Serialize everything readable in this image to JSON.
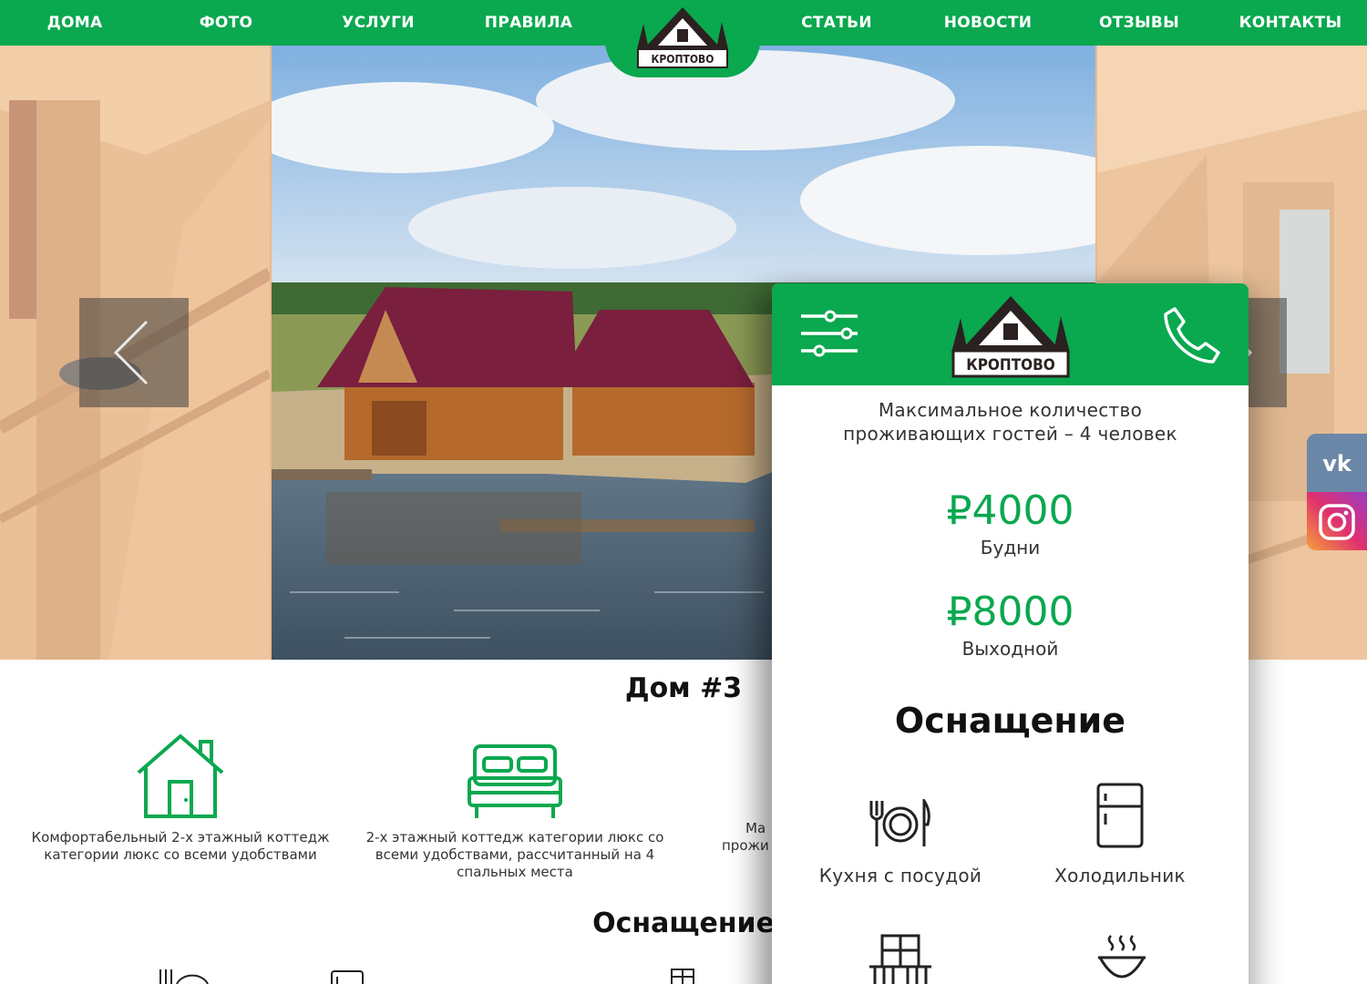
{
  "nav": {
    "items": [
      {
        "label": "ДОМА"
      },
      {
        "label": "ФОТО"
      },
      {
        "label": "УСЛУГИ"
      },
      {
        "label": "ПРАВИЛА"
      },
      {
        "label": "СТАТЬИ"
      },
      {
        "label": "НОВОСТИ"
      },
      {
        "label": "ОТЗЫВЫ"
      },
      {
        "label": "КОНТАКТЫ"
      }
    ],
    "logo_text": "КРОПТОВО"
  },
  "colors": {
    "brand_green": "#0aa84f",
    "roof": "#7a1f3d",
    "vk": "#6b87a8"
  },
  "hero": {
    "arrow_left_icon": "chevron-left-icon",
    "arrow_right_icon": "chevron-right-icon"
  },
  "social": [
    {
      "name": "vk-icon"
    },
    {
      "name": "instagram-icon"
    }
  ],
  "house": {
    "title": "Дом #3",
    "features": [
      {
        "icon": "house-icon",
        "text": "Комфортабельный 2-х этажный коттедж категории люкс со всеми удобствами"
      },
      {
        "icon": "bed-icon",
        "text": "2-х этажный коттедж категории люкс со всеми удобствами, рассчитанный на 4 спальных места"
      },
      {
        "icon": "",
        "text": "Ма"
      },
      {
        "icon": "",
        "text": "прожи"
      }
    ],
    "section_title": "Оснащение"
  },
  "mobile": {
    "logo_text": "КРОПТОВО",
    "capacity_line1": "Максимальное количество",
    "capacity_line2": "проживающих гостей – 4 человек",
    "prices": [
      {
        "amount": "₽4000",
        "label": "Будни"
      },
      {
        "amount": "₽8000",
        "label": "Выходной"
      }
    ],
    "section_title": "Оснащение",
    "equipment": [
      {
        "icon": "plate-cutlery-icon",
        "label": "Кухня с посудой"
      },
      {
        "icon": "fridge-icon",
        "label": "Холодильник"
      },
      {
        "icon": "balcony-icon",
        "label": ""
      },
      {
        "icon": "grill-icon",
        "label": ""
      }
    ]
  }
}
